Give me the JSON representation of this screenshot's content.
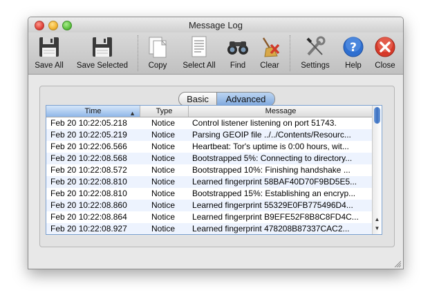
{
  "window": {
    "title": "Message Log"
  },
  "toolbar": {
    "save_all": "Save All",
    "save_selected": "Save Selected",
    "copy": "Copy",
    "select_all": "Select All",
    "find": "Find",
    "clear": "Clear",
    "settings": "Settings",
    "help": "Help",
    "close": "Close"
  },
  "segmented": {
    "basic": "Basic",
    "advanced": "Advanced",
    "selected": "Advanced"
  },
  "table": {
    "columns": {
      "time": "Time",
      "type": "Type",
      "message": "Message"
    },
    "sort_indicator": "▲",
    "rows": [
      {
        "time": "Feb 20 10:22:05.218",
        "type": "Notice",
        "message": "Control listener listening on port 51743."
      },
      {
        "time": "Feb 20 10:22:05.219",
        "type": "Notice",
        "message": "Parsing GEOIP file ../../Contents/Resourc..."
      },
      {
        "time": "Feb 20 10:22:06.566",
        "type": "Notice",
        "message": "Heartbeat: Tor's uptime is 0:00 hours, wit..."
      },
      {
        "time": "Feb 20 10:22:08.568",
        "type": "Notice",
        "message": "Bootstrapped 5%: Connecting to directory..."
      },
      {
        "time": "Feb 20 10:22:08.572",
        "type": "Notice",
        "message": "Bootstrapped 10%: Finishing handshake ..."
      },
      {
        "time": "Feb 20 10:22:08.810",
        "type": "Notice",
        "message": "Learned fingerprint 58BAF40D70F9BD5E5..."
      },
      {
        "time": "Feb 20 10:22:08.810",
        "type": "Notice",
        "message": "Bootstrapped 15%: Establishing an encryp..."
      },
      {
        "time": "Feb 20 10:22:08.860",
        "type": "Notice",
        "message": "Learned fingerprint 55329E0FB775496D4..."
      },
      {
        "time": "Feb 20 10:22:08.864",
        "type": "Notice",
        "message": "Learned fingerprint B9EFE52F8B8C8FD4C..."
      },
      {
        "time": "Feb 20 10:22:08.927",
        "type": "Notice",
        "message": "Learned fingerprint 478208B87337CAC2..."
      }
    ]
  },
  "icons": {
    "save_all": "floppy-disk-icon",
    "save_selected": "floppy-disk-icon",
    "copy": "documents-icon",
    "select_all": "document-lines-icon",
    "find": "binoculars-icon",
    "clear": "broom-icon",
    "settings": "wrench-screwdriver-icon",
    "help": "question-icon",
    "close": "close-x-icon"
  },
  "colors": {
    "selection_blue": "#7fa8dd",
    "row_alt": "#edf3fe",
    "help_blue": "#2f6fd0",
    "close_red": "#d63a2a"
  }
}
